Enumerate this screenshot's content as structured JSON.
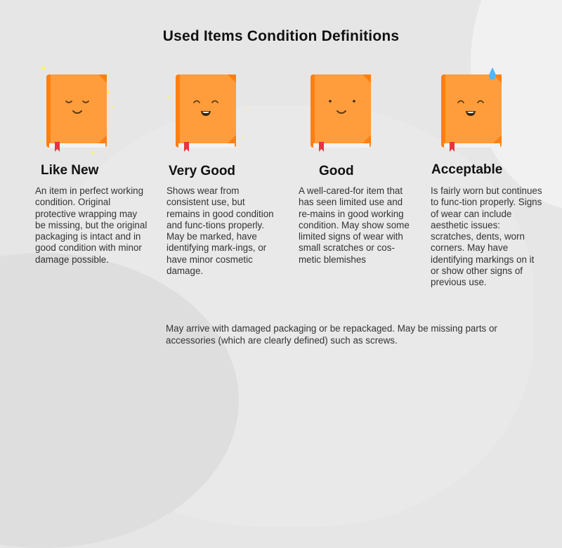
{
  "title": "Used Items Condition Definitions",
  "colors": {
    "book_cover": "#ff9d3c",
    "book_spine": "#ff7f11",
    "bookmark": "#e8343f",
    "pages": "#f2f2f2",
    "sparkle": "#fff36b",
    "sweat_drop": "#4fb6ff",
    "background": "#e6e6e6"
  },
  "conditions": [
    {
      "name": "Like New",
      "face": "eyes-closed-smile",
      "decoration": "sparkles",
      "description": "An item in perfect working condition. Original protective wrapping may be missing, but the original packaging is intact and in good condition with minor damage possible."
    },
    {
      "name": "Very Good",
      "face": "happy-open-smile",
      "decoration": "small-sparkles",
      "description": "Shows wear from consistent use, but remains in good condition and func-tions properly. May be marked, have identifying mark-ings, or have minor cosmetic damage."
    },
    {
      "name": "Good",
      "face": "dot-eyes-smile",
      "decoration": "none",
      "description": "A well-cared-for item that has seen limited use and re-mains in good working condition. May show some limited signs of wear with small scratches or cos-metic blemishes"
    },
    {
      "name": "Acceptable",
      "face": "happy-open-smile",
      "decoration": "sweat-drop",
      "description": "Is fairly worn but continues to func-tion properly. Signs of wear can include aesthetic issues: scratches, dents, worn corners. May have identifying markings on it or show other signs of previous use."
    }
  ],
  "footnote": "May arrive with damaged packaging or be repackaged. May be missing parts or accessories (which are clearly defined) such as screws."
}
